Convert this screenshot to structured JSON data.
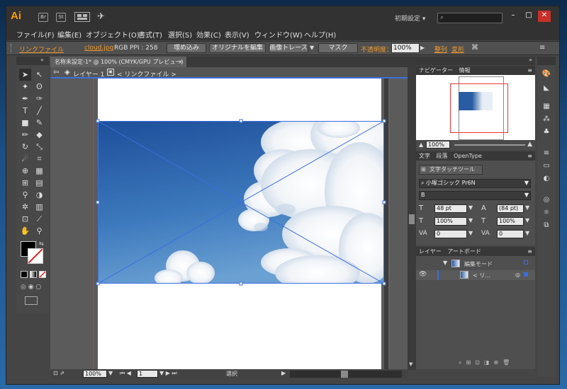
{
  "app": {
    "logo": "Ai",
    "bridge_label": "Br",
    "stock_label": "St",
    "workspace": "初期設定 ▾"
  },
  "menus": [
    "ファイル(F)",
    "編集(E)",
    "オブジェクト(O)",
    "書式(T)",
    "選択(S)",
    "効果(C)",
    "表示(V)",
    "ウィンドウ(W)",
    "ヘルプ(H)"
  ],
  "control": {
    "link_file": "リンクファイル",
    "filename": "cloud.jpg",
    "color_mode": "RGB",
    "ppi": "PPI : 258",
    "embed": "埋め込み",
    "edit_original": "オリジナルを編集",
    "image_trace": "画像トレース",
    "mask": "マスク",
    "opacity_label": "不透明度：",
    "opacity_value": "100%",
    "align": "整列",
    "transform": "変形"
  },
  "document": {
    "tab_title": "名称未設定-1* @ 100% (CMYK/GPU プレビュー)",
    "layer": "レイヤー 1",
    "linked": "< リンクファイル >",
    "zoom": "100%",
    "artboard_num": "1",
    "status": "選択"
  },
  "navigator": {
    "tab1": "ナビゲーター",
    "tab2": "情報",
    "zoom": "100%"
  },
  "character": {
    "tab1": "文字",
    "tab2": "段落",
    "tab3": "OpenType",
    "touch_tool": "文字タッチツール",
    "font_family": "小塚ゴシック Pr6N",
    "font_style": "B",
    "font_size": "48 pt",
    "leading": "(84 pt)",
    "vscale": "100%",
    "hscale": "100%",
    "kerning": "0",
    "tracking": "0"
  },
  "layers": {
    "tab1": "レイヤー",
    "tab2": "アートボード",
    "row1": "編集モード",
    "row2": "< リ..."
  },
  "colors": {
    "accent": "#f29a2a",
    "selection": "#3b6fe0",
    "bleed": "#d23a3a"
  }
}
